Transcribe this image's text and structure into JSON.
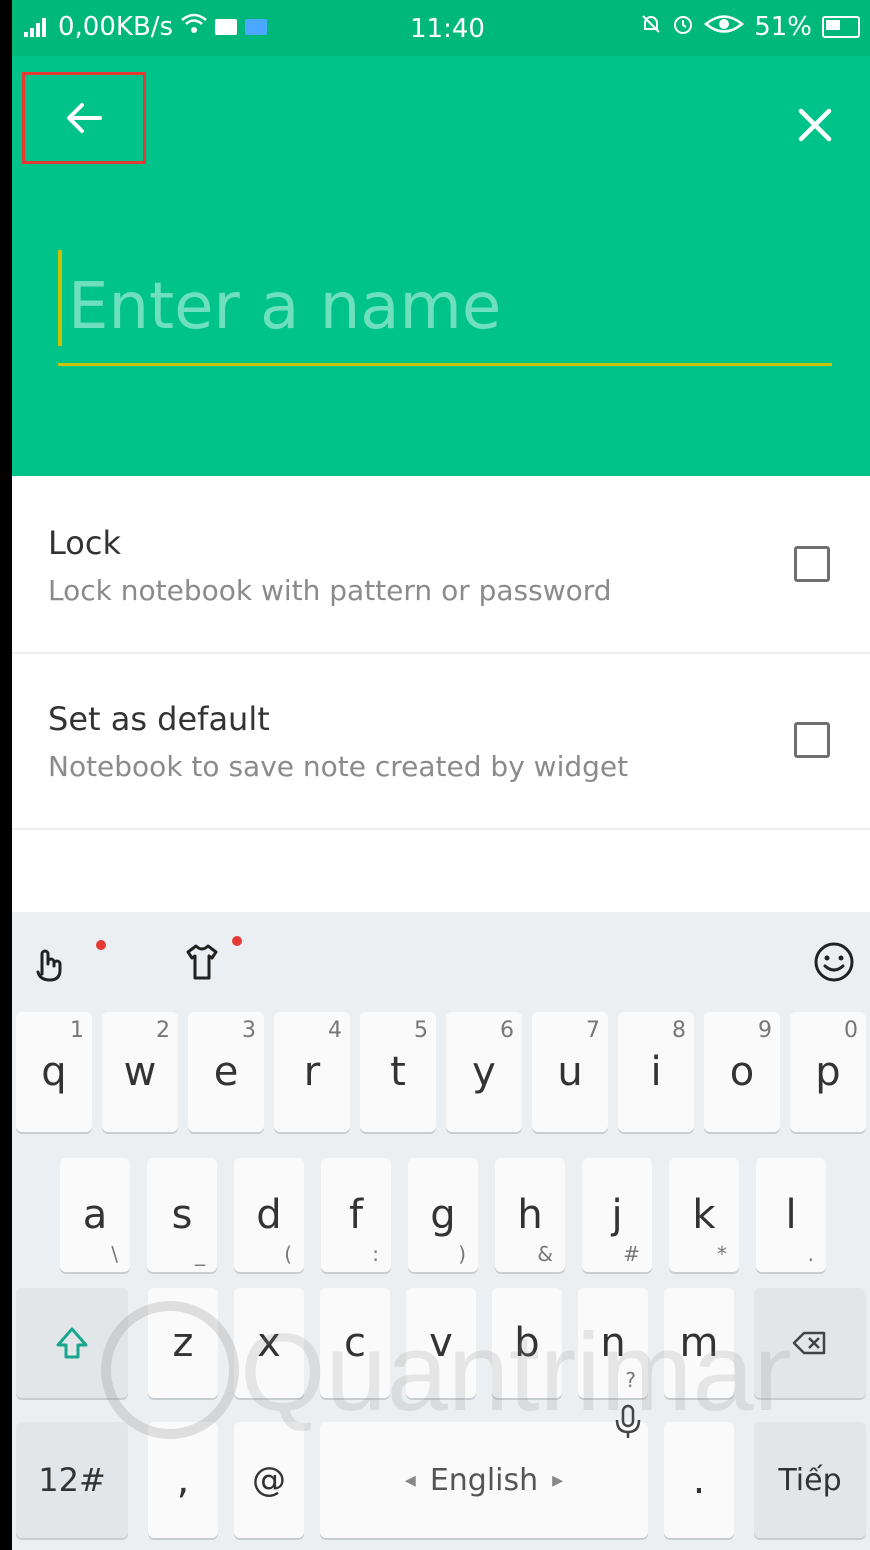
{
  "statusbar": {
    "network_speed": "0,00KB/s",
    "time": "11:40",
    "battery_percent": "51%"
  },
  "appbar": {
    "name_placeholder": "Enter a name"
  },
  "settings": {
    "lock": {
      "title": "Lock",
      "subtitle": "Lock notebook with pattern or password",
      "checked": false
    },
    "default": {
      "title": "Set as default",
      "subtitle": "Notebook to save note created by widget",
      "checked": false
    }
  },
  "keyboard": {
    "row1": [
      {
        "label": "q",
        "sup": "1"
      },
      {
        "label": "w",
        "sup": "2"
      },
      {
        "label": "e",
        "sup": "3"
      },
      {
        "label": "r",
        "sup": "4"
      },
      {
        "label": "t",
        "sup": "5"
      },
      {
        "label": "y",
        "sup": "6"
      },
      {
        "label": "u",
        "sup": "7"
      },
      {
        "label": "i",
        "sup": "8"
      },
      {
        "label": "o",
        "sup": "9"
      },
      {
        "label": "p",
        "sup": "0"
      }
    ],
    "row2": [
      {
        "label": "a",
        "sub": "\\"
      },
      {
        "label": "s",
        "sub": "_"
      },
      {
        "label": "d",
        "sub": "("
      },
      {
        "label": "f",
        "sub": ":"
      },
      {
        "label": "g",
        "sub": ")"
      },
      {
        "label": "h",
        "sub": "&"
      },
      {
        "label": "j",
        "sub": "#"
      },
      {
        "label": "k",
        "sub": "*"
      },
      {
        "label": "l",
        "sub": "."
      }
    ],
    "row3": [
      {
        "label": "z"
      },
      {
        "label": "x"
      },
      {
        "label": "c"
      },
      {
        "label": "v"
      },
      {
        "label": "b"
      },
      {
        "label": "n",
        "sub": "?"
      },
      {
        "label": "m"
      }
    ],
    "bottom": {
      "symbols_key": "12#",
      "comma_key": ",",
      "at_key": "@",
      "space_label": "English",
      "period_key": ".",
      "action_key": "Tiếp"
    }
  },
  "watermark": {
    "text": "Quantrimang"
  }
}
